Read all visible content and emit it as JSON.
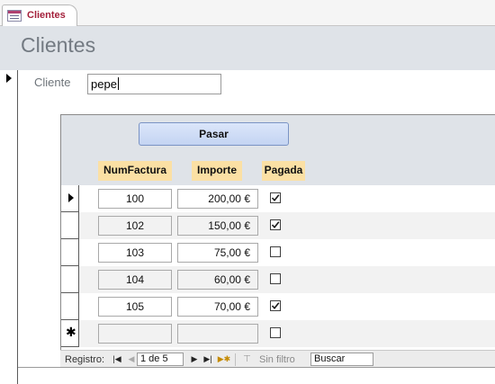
{
  "tab": {
    "label": "Clientes",
    "icon": "form-icon"
  },
  "form": {
    "title": "Clientes"
  },
  "cliente": {
    "label": "Cliente",
    "value": "pepe"
  },
  "subform": {
    "button_label": "Pasar",
    "columns": {
      "num": "NumFactura",
      "importe": "Importe",
      "pagada": "Pagada"
    },
    "rows": [
      {
        "num": "100",
        "importe": "200,00 €",
        "pagada": true,
        "current": true
      },
      {
        "num": "102",
        "importe": "150,00 €",
        "pagada": true
      },
      {
        "num": "103",
        "importe": "75,00 €",
        "pagada": false
      },
      {
        "num": "104",
        "importe": "60,00 €",
        "pagada": false
      },
      {
        "num": "105",
        "importe": "70,00 €",
        "pagada": true
      },
      {
        "num": "",
        "importe": "",
        "pagada": false,
        "new": true
      }
    ]
  },
  "navigation": {
    "registro_label": "Registro:",
    "position": "1 de 5",
    "filter_label": "Sin filtro",
    "search_placeholder": "Buscar",
    "first_icon": "first-record-icon",
    "prev_icon": "prev-record-icon",
    "next_icon": "next-record-icon",
    "last_icon": "last-record-icon",
    "new_icon": "new-record-icon"
  },
  "colors": {
    "header_bg": "#dfe3e8",
    "column_header_bg": "#fbe0a4",
    "tab_text": "#a31f3a",
    "button_bg": "#c4d4f2"
  }
}
